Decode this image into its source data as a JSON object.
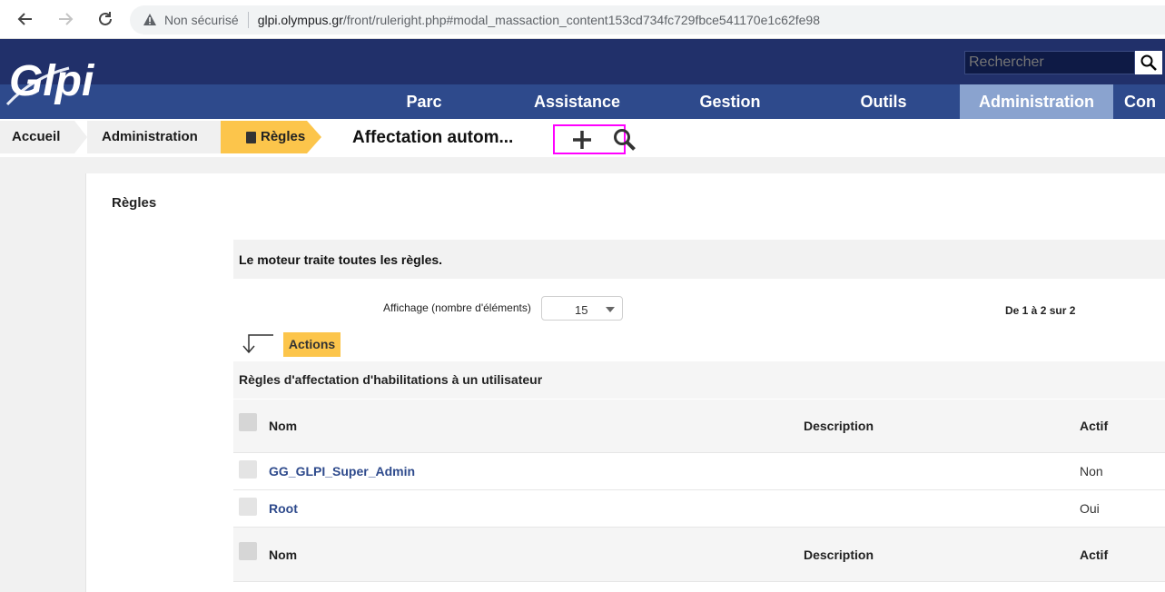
{
  "browser": {
    "insecure_label": "Non sécurisé",
    "url_host": "glpi.olympus.gr",
    "url_path": "/front/ruleright.php#modal_massaction_content153cd734fc729fbce541170e1c62fe98"
  },
  "header": {
    "logo_text": "Glpi",
    "search_placeholder": "Rechercher"
  },
  "menu": {
    "items": [
      {
        "label": "Parc"
      },
      {
        "label": "Assistance"
      },
      {
        "label": "Gestion"
      },
      {
        "label": "Outils"
      },
      {
        "label": "Administration",
        "active": true
      },
      {
        "label": "Con"
      }
    ]
  },
  "breadcrumb": {
    "items": [
      "Accueil",
      "Administration",
      "Règles"
    ],
    "page_title": "Affectation autom..."
  },
  "content": {
    "section_title": "Règles",
    "engine_text": "Le moteur traite toutes les règles.",
    "display_label": "Affichage (nombre d'éléments)",
    "display_value": "15",
    "pager_text": "De 1 à 2 sur 2",
    "actions_label": "Actions",
    "table_caption": "Règles d'affectation d'habilitations à un utilisateur",
    "columns": [
      "Nom",
      "Description",
      "Actif"
    ],
    "rows": [
      {
        "name": "GG_GLPI_Super_Admin",
        "description": "",
        "active": "Non"
      },
      {
        "name": "Root",
        "description": "",
        "active": "Oui"
      }
    ]
  },
  "colors": {
    "header_dark": "#21306a",
    "nav_blue": "#2e4a8c",
    "active_tab": "#8aa3cf",
    "accent_yellow": "#fcc54b",
    "highlight": "#ff00ff"
  }
}
